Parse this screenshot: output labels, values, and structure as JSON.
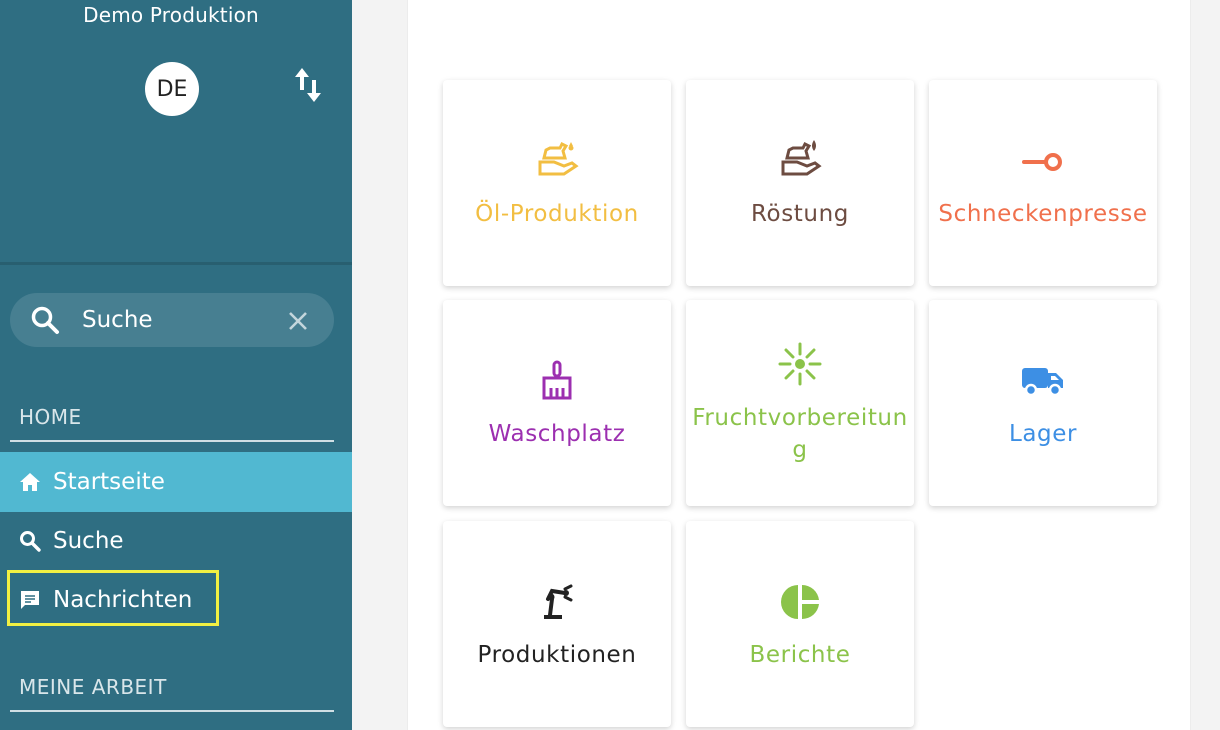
{
  "sidebar": {
    "app_title": "Demo Produktion",
    "avatar_initials": "DE",
    "search": {
      "placeholder": "Suche"
    },
    "sections": [
      {
        "label": "HOME"
      },
      {
        "label": "MEINE ARBEIT"
      }
    ],
    "items": [
      {
        "label": "Startseite",
        "icon": "home-icon",
        "active": true
      },
      {
        "label": "Suche",
        "icon": "search-icon",
        "active": false
      },
      {
        "label": "Nachrichten",
        "icon": "message-icon",
        "active": false
      }
    ],
    "colors": {
      "background": "#2f6e82",
      "active_item": "#51b8d1",
      "highlight": "#f2f043"
    }
  },
  "tiles": [
    {
      "label": "Öl-Produktion",
      "icon": "oil-hand-icon",
      "color": "#f2be42"
    },
    {
      "label": "Röstung",
      "icon": "roast-hand-icon",
      "color": "#6d4c41"
    },
    {
      "label": "Schneckenpresse",
      "icon": "key-icon",
      "color": "#f0704c"
    },
    {
      "label": "Waschplatz",
      "icon": "broom-icon",
      "color": "#9c2fb0"
    },
    {
      "label": "Fruchtvorbereitung",
      "icon": "sunburst-icon",
      "color": "#8bc34a"
    },
    {
      "label": "Lager",
      "icon": "truck-icon",
      "color": "#3d8fe4"
    },
    {
      "label": "Produktionen",
      "icon": "robot-arm-icon",
      "color": "#222222"
    },
    {
      "label": "Berichte",
      "icon": "pie-chart-icon",
      "color": "#8bc34a"
    }
  ]
}
